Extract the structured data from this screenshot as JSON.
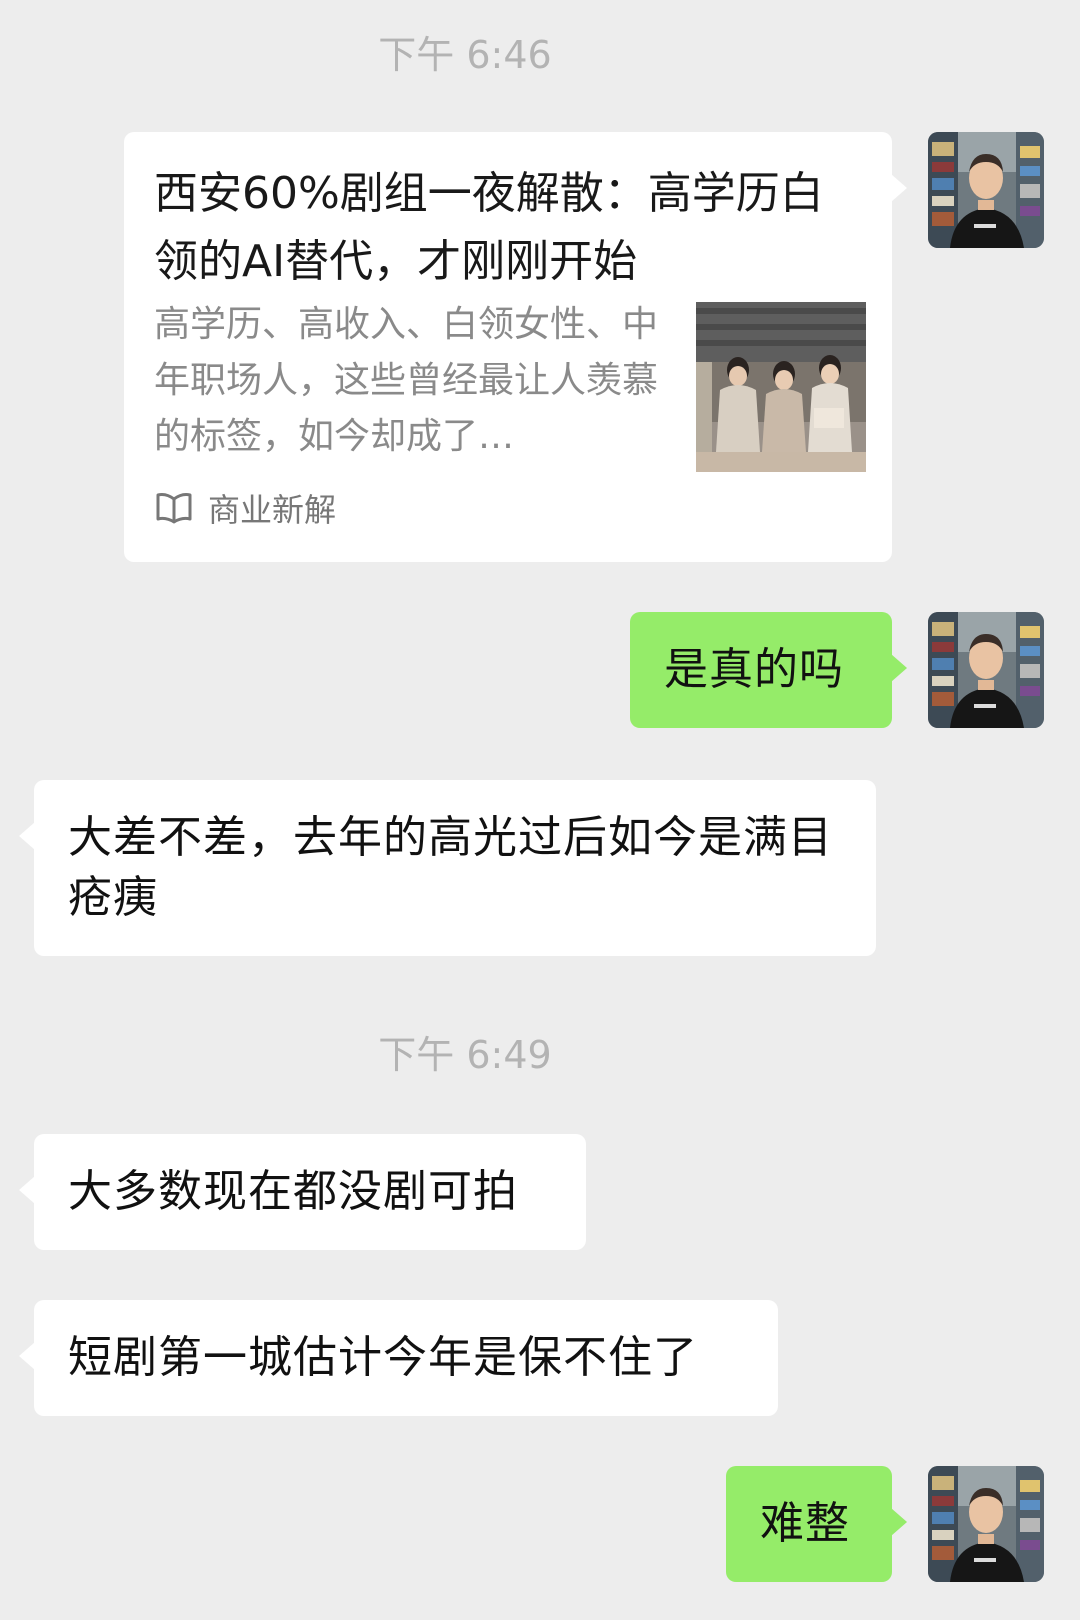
{
  "chat": {
    "timestamp_1": "下午 6:46",
    "timestamp_2": "下午 6:49",
    "link_card": {
      "title": "西安60%剧组一夜解散：高学历白领的AI替代，才刚刚开始",
      "description": "高学历、高收入、白领女性、中年职场人，这些曾经最让人羡慕的标签，如今却成了…",
      "source": "商业新解",
      "source_icon": "book-icon",
      "thumbnail": "article-thumbnail"
    },
    "messages": [
      {
        "side": "right",
        "text": "是真的吗"
      },
      {
        "side": "left",
        "text": "大差不差，去年的高光过后如今是满目疮痍"
      },
      {
        "side": "left",
        "text": "大多数现在都没剧可拍"
      },
      {
        "side": "left",
        "text": "短剧第一城估计今年是保不住了"
      },
      {
        "side": "right",
        "text": "难整"
      }
    ]
  },
  "colors": {
    "background": "#ededed",
    "bubble_self": "#95ec69",
    "bubble_other": "#ffffff",
    "timestamp": "#b3b3b3"
  }
}
